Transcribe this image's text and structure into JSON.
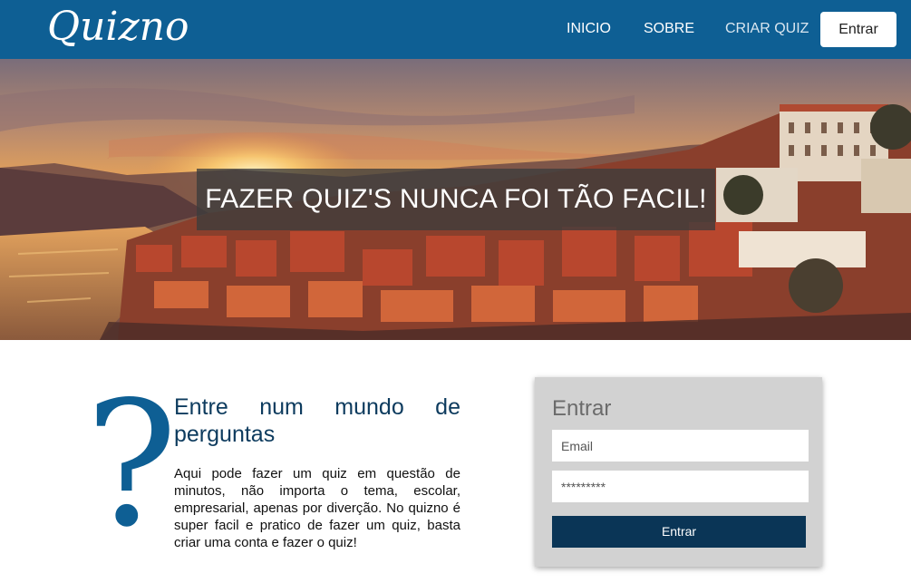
{
  "header": {
    "logo": "Quizno",
    "nav": {
      "inicio": "INICIO",
      "sobre": "SOBRE",
      "criar_quiz": "CRIAR QUIZ",
      "entrar": "Entrar"
    }
  },
  "hero": {
    "title": "FAZER QUIZ'S NUNCA FOI TÃO FACIL!"
  },
  "intro": {
    "symbol": "?",
    "title_line1": "Entre num mundo de",
    "title_line2": "perguntas",
    "text": "Aqui pode fazer um quiz em questão de minutos, não importa o tema, escolar, empresarial, apenas por diverção. No quizno é super facil e pratico de fazer um quiz, basta criar uma conta e fazer o quiz!"
  },
  "login": {
    "title": "Entrar",
    "email_placeholder": "Email",
    "password_placeholder": "*********",
    "submit": "Entrar"
  },
  "colors": {
    "header": "#0e5f94",
    "accent": "#0e5f94",
    "button": "#0a3556",
    "card": "#d2d2d2"
  }
}
